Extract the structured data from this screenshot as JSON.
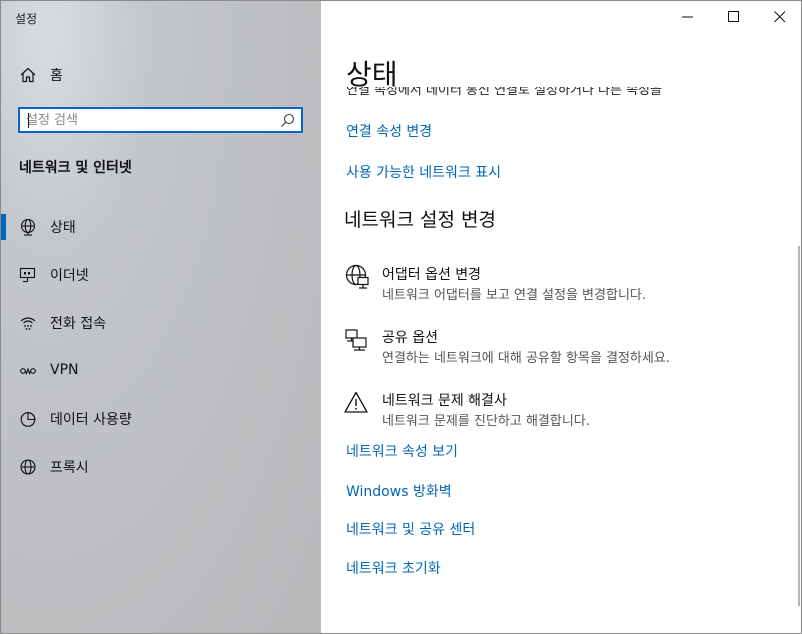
{
  "window": {
    "title": "설정"
  },
  "sidebar": {
    "home_label": "홈",
    "search": {
      "placeholder": "설정 검색",
      "value": ""
    },
    "section_title": "네트워크 및 인터넷",
    "items": [
      {
        "label": "상태",
        "icon": "globe-network-icon",
        "active": true
      },
      {
        "label": "이더넷",
        "icon": "ethernet-icon",
        "active": false
      },
      {
        "label": "전화 접속",
        "icon": "dial-up-icon",
        "active": false
      },
      {
        "label": "VPN",
        "icon": "vpn-icon",
        "active": false
      },
      {
        "label": "데이터 사용량",
        "icon": "data-usage-icon",
        "active": false
      },
      {
        "label": "프록시",
        "icon": "globe-icon",
        "active": false
      }
    ]
  },
  "main": {
    "title": "상태",
    "cut_off_text": "연결 속성에서 데이터 통신 연결로 설정하거나 다른 속성을 변경할 수 있습니다.",
    "top_links": [
      "연결 속성 변경",
      "사용 가능한 네트워크 표시"
    ],
    "section_heading": "네트워크 설정 변경",
    "options": [
      {
        "title": "어댑터 옵션 변경",
        "desc": "네트워크 어댑터를 보고 연결 설정을 변경합니다.",
        "icon": "adapter-icon"
      },
      {
        "title": "공유 옵션",
        "desc": "연결하는 네트워크에 대해 공유할 항목을 결정하세요.",
        "icon": "sharing-icon"
      },
      {
        "title": "네트워크 문제 해결사",
        "desc": "네트워크 문제를 진단하고 해결합니다.",
        "icon": "warning-icon"
      }
    ],
    "bottom_links": [
      "네트워크 속성 보기",
      "Windows 방화벽",
      "네트워크 및 공유 센터",
      "네트워크 초기화"
    ]
  },
  "colors": {
    "accent": "#0067c0",
    "link": "#0067b8",
    "sidebar_bg": "#bebfc2"
  }
}
